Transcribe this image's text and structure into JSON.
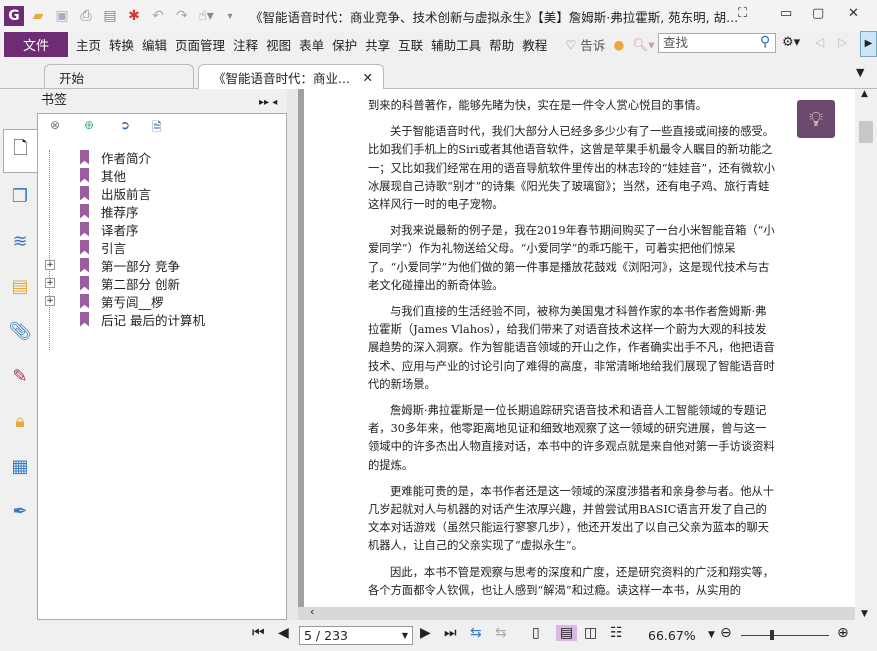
{
  "window": {
    "title": "《智能语音时代：商业竞争、技术创新与虚拟永生》【美】詹姆斯·弗拉霍斯, 苑东明, 胡..."
  },
  "menu": {
    "file": "文件",
    "items": [
      "主页",
      "转换",
      "编辑",
      "页面管理",
      "注释",
      "视图",
      "表单",
      "保护",
      "共享",
      "互联",
      "辅助工具",
      "帮助",
      "教程"
    ],
    "tell": "告诉",
    "search_placeholder": "查找"
  },
  "tabs": [
    {
      "label": "开始"
    },
    {
      "label": "《智能语音时代：商业..."
    }
  ],
  "panel": {
    "title": "书签",
    "bookmarks": [
      {
        "label": "作者简介",
        "expandable": false
      },
      {
        "label": "其他",
        "expandable": false
      },
      {
        "label": "出版前言",
        "expandable": false
      },
      {
        "label": "推荐序",
        "expandable": false
      },
      {
        "label": "译者序",
        "expandable": false
      },
      {
        "label": "引言",
        "expandable": false
      },
      {
        "label": "第一部分 竞争",
        "expandable": true
      },
      {
        "label": "第二部分 创新",
        "expandable": true
      },
      {
        "label": "第亐闾__椤",
        "expandable": true
      },
      {
        "label": "后记 最后的计算机",
        "expandable": false
      }
    ]
  },
  "document": {
    "paragraphs": [
      "到来的科普著作，能够先睹为快，实在是一件令人赏心悦目的事情。",
      "关于智能语音时代，我们大部分人已经多多少少有了一些直接或间接的感受。比如我们手机上的Siri或者其他语音软件，这曾是苹果手机最令人瞩目的新功能之一；又比如我们经常在用的语音导航软件里传出的林志玲的“娃娃音”，还有微软小冰展现自己诗歌“别才”的诗集《阳光失了玻璃窗》；当然，还有电子鸡、旅行青蛙这样风行一时的电子宠物。",
      "对我来说最新的例子是，我在2019年春节期间购买了一台小米智能音箱（“小爱同学”）作为礼物送给父母。“小爱同学”的乖巧能干，可着实把他们惊呆了。“小爱同学”为他们做的第一件事是播放花鼓戏《浏阳河》，这是现代技术与古老文化碰撞出的新奇体验。",
      "与我们直接的生活经验不同，被称为美国鬼才科普作家的本书作者詹姆斯·弗拉霍斯（James Vlahos），给我们带来了对语音技术这样一个蔚为大观的科技发展趋势的深入洞察。作为智能语音领域的开山之作，作者确实出手不凡，他把语音技术、应用与产业的讨论引向了难得的高度，非常清晰地给我们展现了智能语音时代的新场景。",
      "詹姆斯·弗拉霍斯是一位长期追踪研究语音技术和语音人工智能领域的专题记者，30多年来，他零距离地见证和细致地观察了这一领域的研究进展，曾与这一领域中的许多杰出人物直接对话，本书中的许多观点就是来自他对第一手访谈资料的提炼。",
      "更难能可贵的是，本书作者还是这一领域的深度涉猎者和亲身参与者。他从十几岁起就对人与机器的对话产生浓厚兴趣，并曾尝试用BASIC语言开发了自己的文本对话游戏（虽然只能运行寥寥几步），他还开发出了以自己父亲为蓝本的聊天机器人，让自己的父亲实现了“虚拟永生”。",
      "因此，本书不管是观察与思考的深度和广度，还是研究资料的广泛和翔实等，各个方面都令人钦佩，也让人感到“解渴”和过瘾。读这样一本书，从实用的"
    ]
  },
  "status": {
    "page": "5 / 233",
    "zoom": "66.67%"
  },
  "colors": {
    "brand": "#6e2c74",
    "bookmark": "#9a5e9e"
  }
}
